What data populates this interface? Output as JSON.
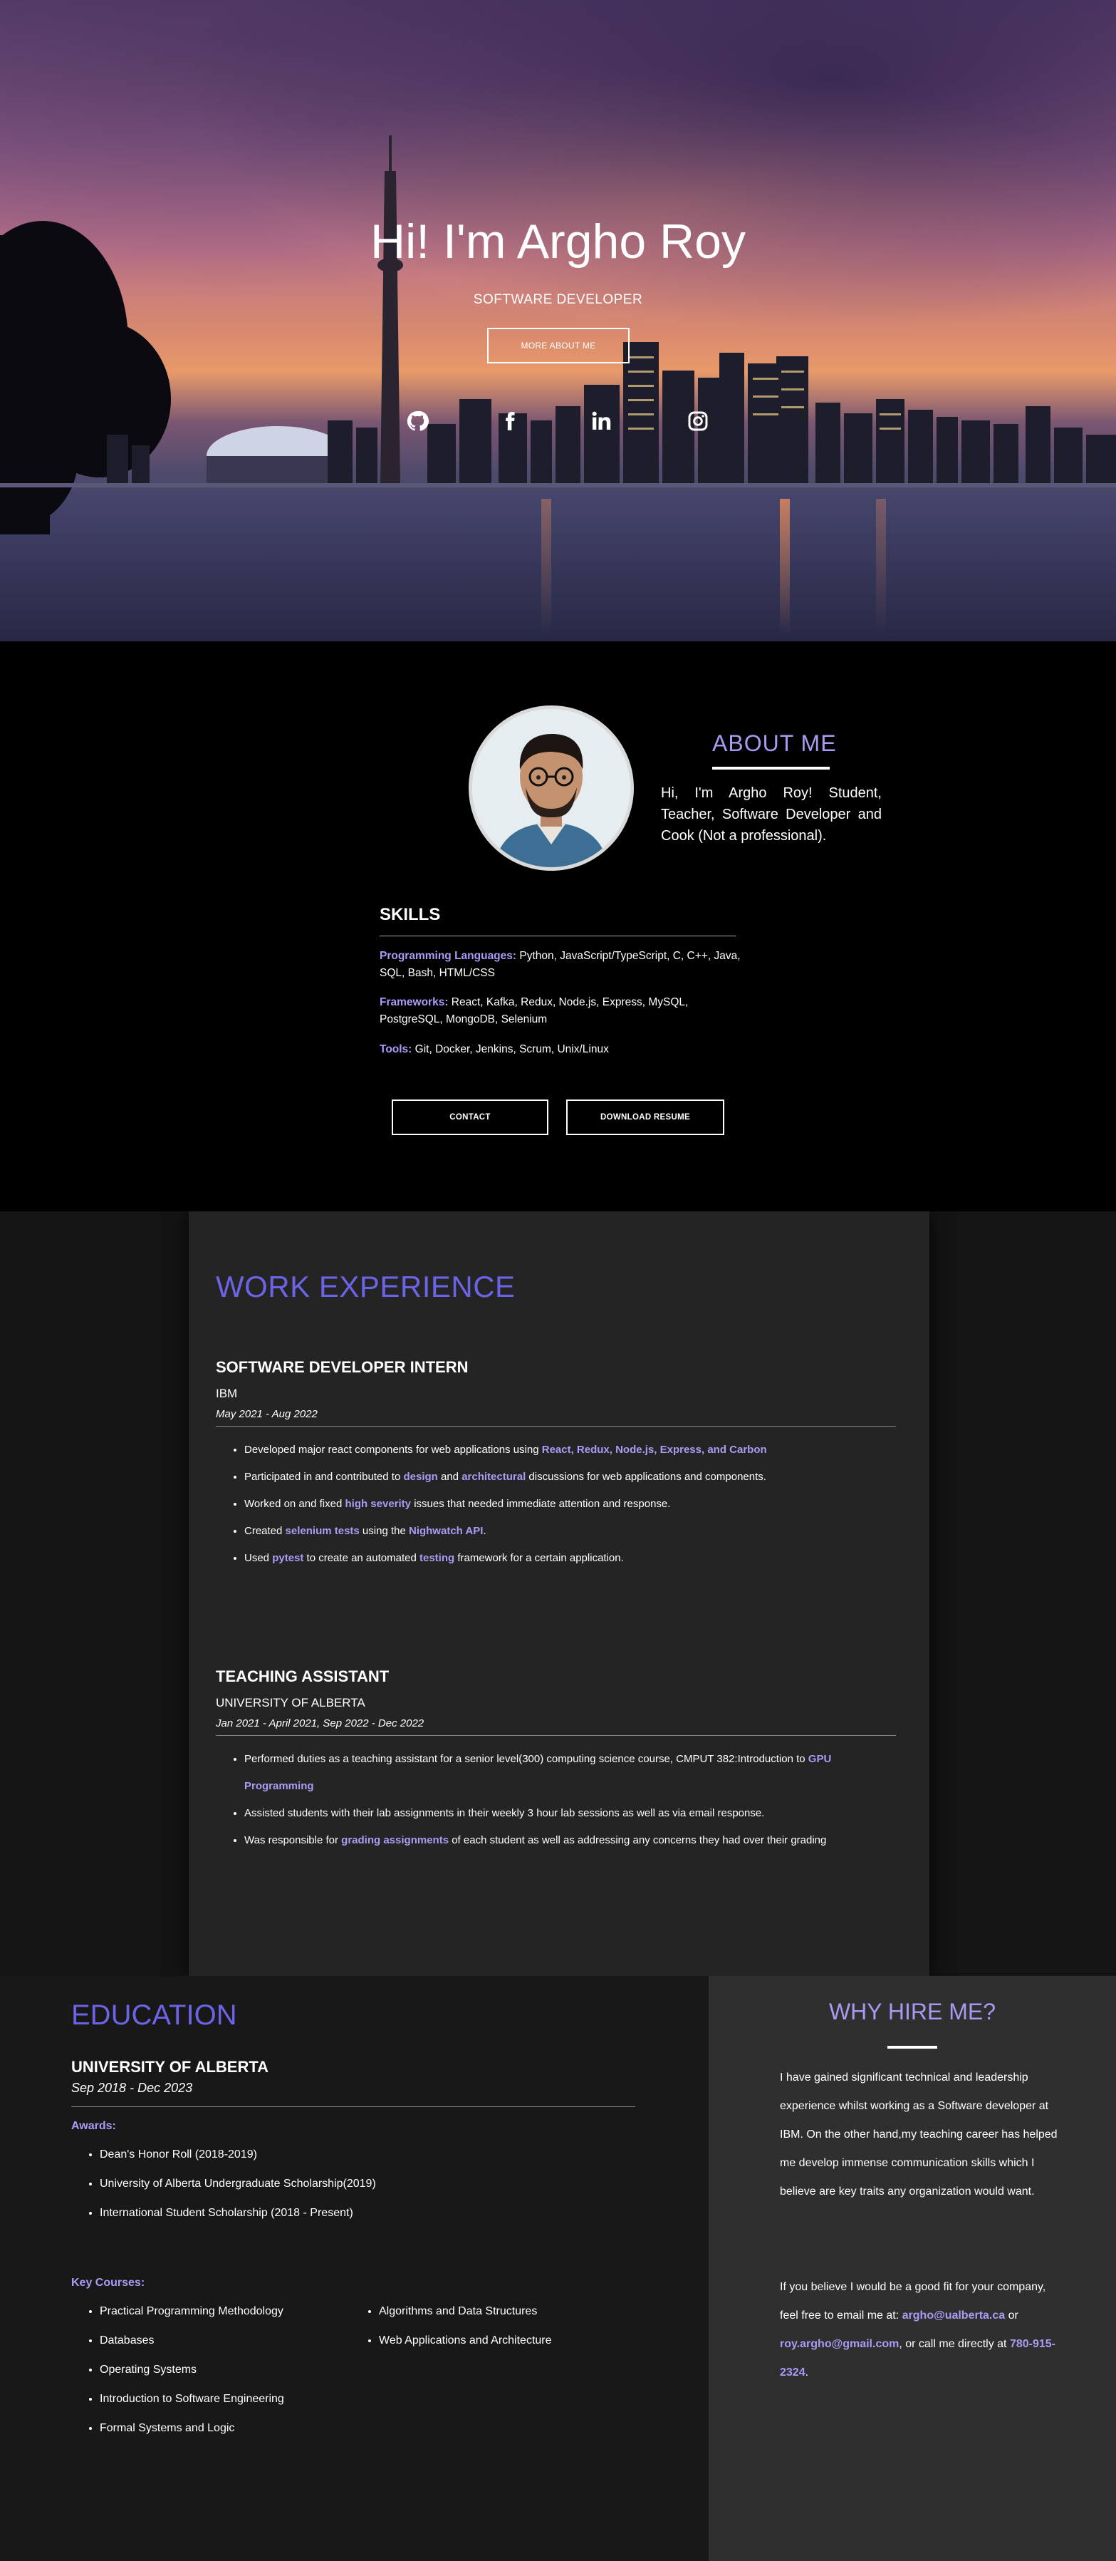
{
  "hero": {
    "title": "Hi! I'm Argho Roy",
    "subtitle": "SOFTWARE DEVELOPER",
    "button": "MORE ABOUT ME",
    "social": [
      "github-icon",
      "facebook-icon",
      "linkedin-icon",
      "instagram-icon"
    ]
  },
  "about": {
    "title": "ABOUT ME",
    "text": "Hi, I'm Argho Roy! Student, Teacher, Software Developer and Cook (Not a professional).",
    "skills_title": "SKILLS",
    "skills": [
      {
        "key": "Programming Languages:",
        "value": " Python, JavaScript/TypeScript, C, C++, Java, SQL, Bash, HTML/CSS"
      },
      {
        "key": "Frameworks:",
        "value": " React, Kafka, Redux, Node.js, Express, MySQL, PostgreSQL, MongoDB, Selenium"
      },
      {
        "key": "Tools:",
        "value": " Git, Docker, Jenkins, Scrum, Unix/Linux"
      }
    ],
    "contact_button": "CONTACT",
    "resume_button": "DOWNLOAD RESUME"
  },
  "work": {
    "title": "WORK EXPERIENCE",
    "jobs": [
      {
        "role": "SOFTWARE DEVELOPER INTERN",
        "org": "IBM",
        "date": "May 2021 - Aug 2022",
        "bullets": [
          [
            {
              "t": "Developed major react components for web applications using "
            },
            {
              "t": "React, Redux, Node.js, Express, and Carbon",
              "h": true
            }
          ],
          [
            {
              "t": "Participated in and contributed to "
            },
            {
              "t": "design",
              "h": true
            },
            {
              "t": " and "
            },
            {
              "t": "architectural",
              "h": true
            },
            {
              "t": " discussions for web applications and components."
            }
          ],
          [
            {
              "t": "Worked on and fixed "
            },
            {
              "t": "high severity",
              "h": true
            },
            {
              "t": " issues that needed immediate attention and response."
            }
          ],
          [
            {
              "t": "Created "
            },
            {
              "t": "selenium tests",
              "h": true
            },
            {
              "t": " using the "
            },
            {
              "t": "Nighwatch API",
              "h": true
            },
            {
              "t": "."
            }
          ],
          [
            {
              "t": "Used "
            },
            {
              "t": "pytest",
              "h": true
            },
            {
              "t": " to create an automated "
            },
            {
              "t": "testing",
              "h": true
            },
            {
              "t": " framework for a certain application."
            }
          ]
        ]
      },
      {
        "role": "TEACHING ASSISTANT",
        "org": "UNIVERSITY OF ALBERTA",
        "date": "Jan 2021 - April 2021, Sep 2022 - Dec 2022",
        "bullets": [
          [
            {
              "t": "Performed duties as a teaching assistant for a senior level(300) computing science course, CMPUT 382:Introduction to "
            },
            {
              "t": "GPU Programming",
              "h": true
            }
          ],
          [
            {
              "t": "Assisted students with their lab assignments in their weekly 3 hour lab sessions as well as via email response."
            }
          ],
          [
            {
              "t": "Was responsible for "
            },
            {
              "t": "grading assignments",
              "h": true
            },
            {
              "t": " of each student as well as addressing any concerns they had over their grading"
            }
          ]
        ]
      }
    ]
  },
  "education": {
    "title": "EDUCATION",
    "school": "UNIVERSITY OF ALBERTA",
    "date": "Sep 2018 - Dec 2023",
    "awards_label": "Awards:",
    "awards": [
      "Dean's Honor Roll (2018-2019)",
      "University of Alberta Undergraduate Scholarship(2019)",
      "International Student Scholarship (2018 - Present)"
    ],
    "courses_label": "Key Courses:",
    "courses_left": [
      "Practical Programming Methodology",
      "Databases",
      "Operating Systems",
      "Introduction to Software Engineering",
      "Formal Systems and Logic"
    ],
    "courses_right": [
      "Algorithms and Data Structures",
      "Web Applications and Architecture"
    ]
  },
  "why": {
    "title": "WHY HIRE ME?",
    "p1": "I have gained significant technical and leadership experience whilst working as a Software developer at IBM. On the other hand,my teaching career has helped me develop immense communication skills which I believe are key traits any organization would want.",
    "p2_a": "If you believe I would be a good fit for your company, feel free to email me at: ",
    "email1": "argho@ualberta.ca",
    "p2_b": " or ",
    "email2": "roy.argho@gmail.com",
    "p2_c": ", or call me directly at ",
    "phone": "780-915-2324",
    "p2_d": "."
  }
}
